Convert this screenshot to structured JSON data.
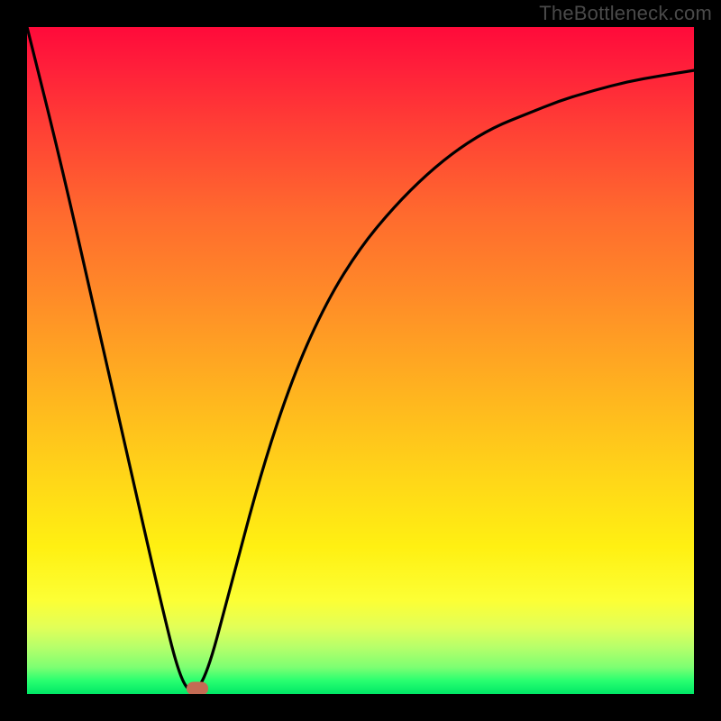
{
  "watermark": "TheBottleneck.com",
  "chart_data": {
    "type": "line",
    "title": "",
    "xlabel": "",
    "ylabel": "",
    "xlim": [
      0,
      100
    ],
    "ylim": [
      0,
      100
    ],
    "grid": false,
    "legend": false,
    "series": [
      {
        "name": "curve",
        "x": [
          0,
          5,
          10,
          15,
          20,
          23,
          25,
          27,
          30,
          35,
          40,
          45,
          50,
          55,
          60,
          65,
          70,
          75,
          80,
          85,
          90,
          95,
          100
        ],
        "values": [
          100,
          80,
          58,
          36,
          14,
          2,
          0,
          3,
          14,
          33,
          48,
          59,
          67,
          73,
          78,
          82,
          85,
          87,
          89,
          90.5,
          91.8,
          92.7,
          93.5
        ]
      }
    ],
    "marker": {
      "x": 25.5,
      "y": 0.8
    },
    "background_gradient_stops": [
      {
        "pos": 0.0,
        "color": "#ff0a3a"
      },
      {
        "pos": 0.5,
        "color": "#ffb41f"
      },
      {
        "pos": 0.85,
        "color": "#fcff35"
      },
      {
        "pos": 1.0,
        "color": "#00e766"
      }
    ]
  }
}
